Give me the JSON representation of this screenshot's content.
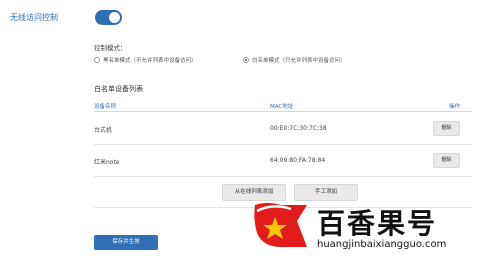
{
  "section": {
    "title": "无线访问控制",
    "toggle_on": true
  },
  "mode": {
    "label": "控制模式：",
    "options": [
      {
        "label": "黑名单模式（不允许列表中设备访问）",
        "checked": false
      },
      {
        "label": "白名单模式（只允许列表中设备访问）",
        "checked": true
      }
    ]
  },
  "whitelist": {
    "title": "白名单设备列表",
    "columns": [
      "设备名称",
      "MAC地址",
      "操作"
    ],
    "rows": [
      {
        "name": "台式机",
        "mac": "00:E0:7C:30:7C:38",
        "action": "删除"
      },
      {
        "name": "红米note",
        "mac": "64:09:80:FA:78:84",
        "action": "删除"
      }
    ]
  },
  "buttons": {
    "add_from_online": "从在线列表添加",
    "add_manual": "手工添加",
    "save": "保存并生效"
  },
  "watermark": {
    "title": "百香果号",
    "url": "huangjinbaixiangguo.com"
  },
  "colors": {
    "accent": "#2f6fb5",
    "watermark_red": "#e21b1b",
    "watermark_star": "#f6c600"
  }
}
